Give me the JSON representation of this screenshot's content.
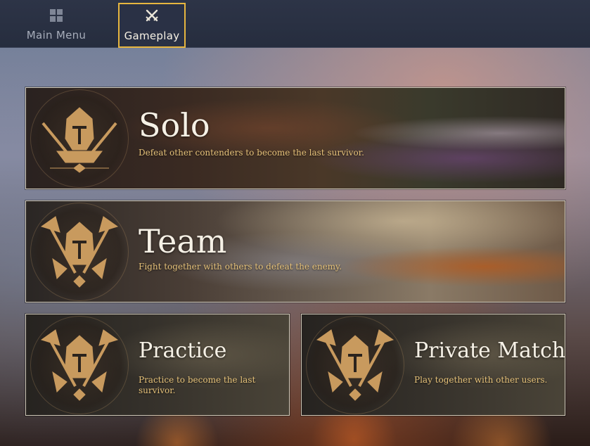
{
  "nav": {
    "tabs": [
      {
        "label": "Main Menu",
        "icon": "grid-icon",
        "active": false
      },
      {
        "label": "Gameplay",
        "icon": "crossed-swords-icon",
        "active": true
      }
    ]
  },
  "modes": {
    "solo": {
      "title": "Solo",
      "description": "Defeat other contenders to become the last survivor.",
      "emblem": "knight-helmet-swords-icon"
    },
    "team": {
      "title": "Team",
      "description": "Fight together with others to defeat the enemy.",
      "emblem": "knight-helmet-axes-icon"
    },
    "practice": {
      "title": "Practice",
      "description": "Practice to become the last survivor.",
      "emblem": "knight-helmet-axes-icon"
    },
    "private_match": {
      "title": "Private Match",
      "description": "Play together with other users.",
      "emblem": "knight-helmet-axes-icon"
    }
  },
  "colors": {
    "accent_gold": "#e7b63f",
    "description_text": "#e6c27a",
    "topbar": "#2a3145"
  }
}
